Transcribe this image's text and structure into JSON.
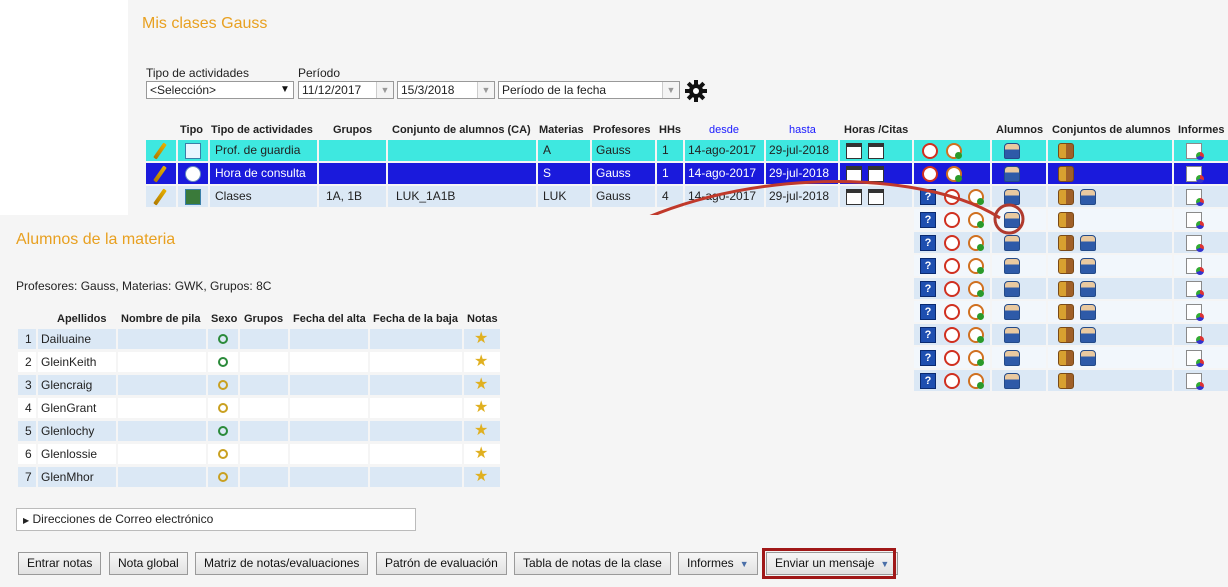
{
  "page": {
    "title": "Mis clases Gauss"
  },
  "filters": {
    "activity_type_label": "Tipo de actividades",
    "activity_type_value": "<Selección>",
    "period_label": "Período",
    "date_from": "11/12/2017",
    "date_to": "15/3/2018",
    "period_mode": "Período de la fecha"
  },
  "main_table": {
    "headers": {
      "tipo": "Tipo",
      "tipo_act": "Tipo de actividades",
      "grupos": "Grupos",
      "conjunto": "Conjunto de alumnos (CA)",
      "materias": "Materias",
      "profesores": "Profesores",
      "hhs": "HHs",
      "desde": "desde",
      "hasta": "hasta",
      "horas": "Horas /Citas",
      "alumnos": "Alumnos",
      "conjuntos": "Conjuntos de alumnos",
      "informes": "Informes"
    },
    "rows": [
      {
        "activity": "Prof. de guardia",
        "groups": "",
        "set": "",
        "subject": "A",
        "teacher": "Gauss",
        "hhs": "1",
        "from": "14-ago-2017",
        "to": "29-jul-2018"
      },
      {
        "activity": "Hora de consulta",
        "groups": "",
        "set": "",
        "subject": "S",
        "teacher": "Gauss",
        "hhs": "1",
        "from": "14-ago-2017",
        "to": "29-jul-2018"
      },
      {
        "activity": "Clases",
        "groups": "1A, 1B",
        "set": "LUK_1A1B",
        "subject": "LUK",
        "teacher": "Gauss",
        "hhs": "4",
        "from": "14-ago-2017",
        "to": "29-jul-2018"
      }
    ]
  },
  "students_panel": {
    "title": "Alumnos de la materia",
    "info": "Profesores: Gauss, Materias: GWK, Grupos: 8C",
    "headers": {
      "apellidos": "Apellidos",
      "nombre": "Nombre de pila",
      "sexo": "Sexo",
      "grupos": "Grupos",
      "alta": "Fecha del alta",
      "baja": "Fecha de la baja",
      "notas": "Notas"
    },
    "students": [
      {
        "num": "1",
        "surname": "Dailuaine",
        "sex": "male"
      },
      {
        "num": "2",
        "surname": "GleinKeith",
        "sex": "male"
      },
      {
        "num": "3",
        "surname": "Glencraig",
        "sex": "female"
      },
      {
        "num": "4",
        "surname": "GlenGrant",
        "sex": "female"
      },
      {
        "num": "5",
        "surname": "Glenlochy",
        "sex": "male"
      },
      {
        "num": "6",
        "surname": "Glenlossie",
        "sex": "female"
      },
      {
        "num": "7",
        "surname": "GlenMhor",
        "sex": "female"
      }
    ],
    "emails_label": "Direcciones de Correo electrónico"
  },
  "buttons": {
    "enter_grades": "Entrar notas",
    "global_grade": "Nota global",
    "matrix": "Matriz de notas/evaluaciones",
    "pattern": "Patrón de evaluación",
    "class_table": "Tabla de notas de la clase",
    "reports": "Informes",
    "send_message": "Enviar un mensaje"
  },
  "colors": {
    "accent": "#e8a020",
    "row_cyan": "#3ee8e0",
    "row_selected": "#1a1adc",
    "row_light": "#dbe8f5",
    "highlight": "#a01818"
  }
}
